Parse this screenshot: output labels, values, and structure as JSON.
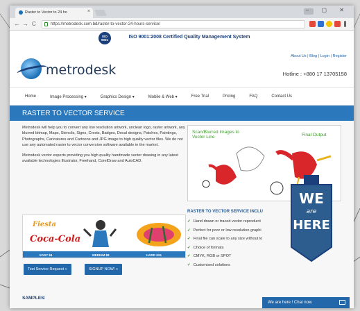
{
  "browser": {
    "tab_title": "Raster to Vector to 24 ho",
    "tab_close": "×",
    "url": "https://metrodesk.com.bd/raster-to-vector-24-hours-service/",
    "window_controls": "– ▢ ✕",
    "back": "←",
    "forward": "→",
    "reload": "C"
  },
  "page": {
    "iso_text": "ISO 9001:2008 Certified Quality Management System",
    "iso_badge": "ISO 9001",
    "brand": "metrodesk",
    "top_links": "About Us | Blog | Login | Register",
    "hotline": "Hotline : +880 17 13705158",
    "nav": [
      "Home",
      "Image Processing ▾",
      "Graphics Design ▾",
      "Mobile & Web ▾",
      "Free Trial",
      "Pricing",
      "FAQ",
      "Contact Us"
    ],
    "hero_title": "RASTER TO VECTOR SERVICE",
    "intro_para": "Metrodesk will help you to convert any low resolution artwork, unclean logo, raster artwork, any blurred bitmap, Maps, Stencils, Signs, Crests, Badges, Decal designs, Patches, Paintings, Photographs, Caricatures and Cartoons and JPG image to high quality vector files. We do not use any automated raster to vector conversion software available in the market.",
    "experts_para": "Metrodesk vector experts providing you high quality handmade vector drawing in any latest available technologies Illustrator, Freehand, CorelDraw and AutoCAD.",
    "samples": [
      {
        "label": "EASY $4"
      },
      {
        "label": "MEDIUM $8"
      },
      {
        "label": "HARD $15"
      }
    ],
    "sample_logo_text": "Coca-Cola",
    "sample_logo_text_2": "Fiesta",
    "btn_test": "Test Service Request »",
    "btn_signup": "SIGNUP NOW! »",
    "samples_heading": "SAMPLES:",
    "illu_left": "Scan/Blurred Images to Vector Line",
    "illu_right": "Final Output",
    "features_title": "RASTER TO VECTOR SERVICE INCLU",
    "features": [
      "Hand drawn or traced vector reproducti",
      "Perfect for poor or low resolution graphi",
      "Final file can scale to any size without lo",
      "Choice of formats",
      "CMYK, RGB or SPOT",
      "Customised solutions"
    ],
    "check": "✔",
    "chat": "We are here ! Chat now.",
    "ribbon": {
      "line1": "WE",
      "line2": "are",
      "line3": "HERE"
    }
  },
  "colors": {
    "brand_blue": "#2b78bd",
    "button_blue": "#2167aa",
    "navy": "#1b3f7a",
    "green": "#3c9a2a"
  }
}
